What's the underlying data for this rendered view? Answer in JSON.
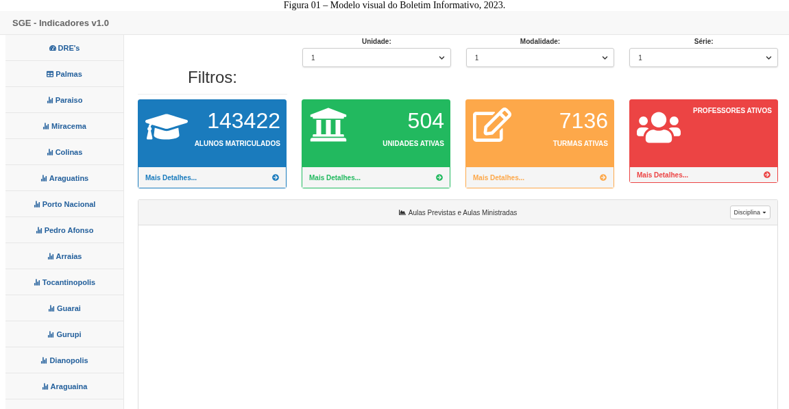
{
  "caption": "Figura 01 – Modelo visual do Boletim Informativo, 2023.",
  "navbar": {
    "brand": "SGE - Indicadores v1.0"
  },
  "sidebar": {
    "items": [
      {
        "label": "DRE's",
        "kind": "dashboard"
      },
      {
        "label": "Palmas",
        "kind": "table"
      },
      {
        "label": "Paraiso",
        "kind": "chart"
      },
      {
        "label": "Miracema",
        "kind": "chart"
      },
      {
        "label": "Colinas",
        "kind": "chart"
      },
      {
        "label": "Araguatins",
        "kind": "chart"
      },
      {
        "label": "Porto Nacional",
        "kind": "chart"
      },
      {
        "label": "Pedro Afonso",
        "kind": "chart"
      },
      {
        "label": "Arraias",
        "kind": "chart"
      },
      {
        "label": "Tocantinopolis",
        "kind": "chart"
      },
      {
        "label": "Guarai",
        "kind": "chart"
      },
      {
        "label": "Gurupi",
        "kind": "chart"
      },
      {
        "label": "Dianopolis",
        "kind": "chart"
      },
      {
        "label": "Araguaina",
        "kind": "chart"
      }
    ]
  },
  "filters": {
    "title": "Filtros:",
    "selects": [
      {
        "label": "Unidade:",
        "value": "1"
      },
      {
        "label": "Modalidade:",
        "value": "1"
      },
      {
        "label": "Série:",
        "value": "1"
      }
    ]
  },
  "cards": [
    {
      "kind": "graduation",
      "number": "143422",
      "label": "ALUNOS MATRICULADOS",
      "link": "Mais Detalhes...",
      "color": "#1a7bbd"
    },
    {
      "kind": "institution",
      "number": "504",
      "label": "UNIDADES ATIVAS",
      "link": "Mais Detalhes...",
      "color": "#22b95f"
    },
    {
      "kind": "edit",
      "number": "7136",
      "label": "TURMAS ATIVAS",
      "link": "Mais Detalhes...",
      "color": "#fda84a"
    },
    {
      "kind": "users",
      "label": "PROFESSORES ATIVOS",
      "link": "Mais Detalhes...",
      "color": "#ec4444"
    }
  ],
  "panel": {
    "title": "Aulas Previstas e Aulas Ministradas",
    "dropdown": "Disciplina"
  }
}
